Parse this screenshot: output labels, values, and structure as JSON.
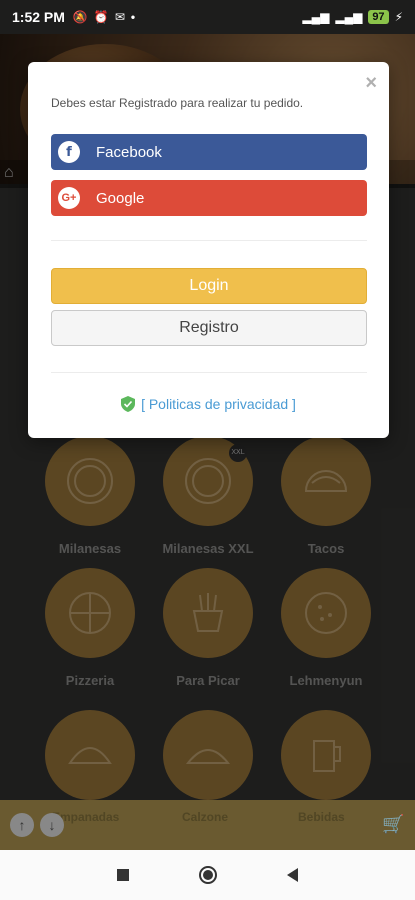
{
  "status_bar": {
    "time": "1:52 PM",
    "battery": "97"
  },
  "modal": {
    "message": "Debes estar Registrado para realizar tu pedido.",
    "facebook_label": "Facebook",
    "google_label": "Google",
    "login_label": "Login",
    "registro_label": "Registro",
    "privacy_label": "[ Politicas de privacidad ]",
    "close_symbol": "×"
  },
  "categories": [
    {
      "label": "Milanesas"
    },
    {
      "label": "Milanesas XXL"
    },
    {
      "label": "Tacos"
    },
    {
      "label": "Pizzeria"
    },
    {
      "label": "Para Picar"
    },
    {
      "label": "Lehmenyun"
    }
  ],
  "bottom_categories": [
    {
      "label": "Empanadas"
    },
    {
      "label": "Calzone"
    },
    {
      "label": "Bebidas"
    }
  ],
  "colors": {
    "accent_gold": "#a7803f",
    "facebook": "#3b5998",
    "google": "#dd4b39",
    "login": "#f0bf4c",
    "privacy_link": "#4a9bd4"
  }
}
